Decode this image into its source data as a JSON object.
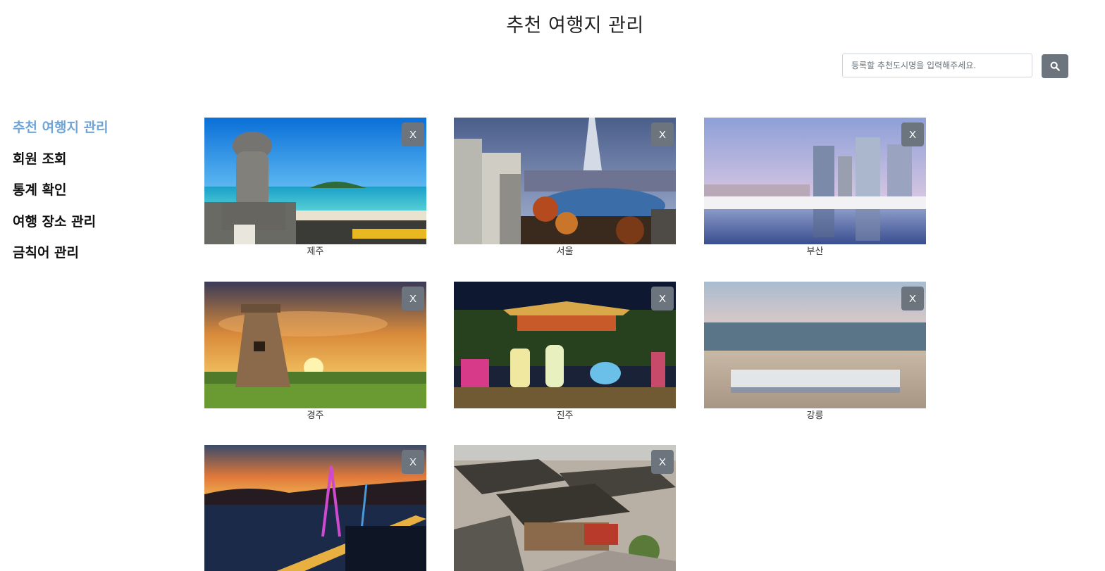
{
  "page": {
    "title": "추천 여행지 관리"
  },
  "search": {
    "placeholder": "등록할 추천도시명을 입력해주세요.",
    "value": "",
    "icon": "search-icon"
  },
  "sidebar": {
    "items": [
      {
        "label": "추천 여행지 관리",
        "active": true
      },
      {
        "label": "회원 조회",
        "active": false
      },
      {
        "label": "통계 확인",
        "active": false
      },
      {
        "label": "여행 장소 관리",
        "active": false
      },
      {
        "label": "금칙어 관리",
        "active": false
      }
    ]
  },
  "cards": [
    {
      "name": "제주",
      "delete_label": "X"
    },
    {
      "name": "서울",
      "delete_label": "X"
    },
    {
      "name": "부산",
      "delete_label": "X"
    },
    {
      "name": "경주",
      "delete_label": "X"
    },
    {
      "name": "진주",
      "delete_label": "X"
    },
    {
      "name": "강릉",
      "delete_label": "X"
    },
    {
      "name": "",
      "delete_label": "X"
    },
    {
      "name": "",
      "delete_label": "X"
    }
  ],
  "colors": {
    "active_menu": "#6fa4d8",
    "button_gray": "#6c757d"
  }
}
